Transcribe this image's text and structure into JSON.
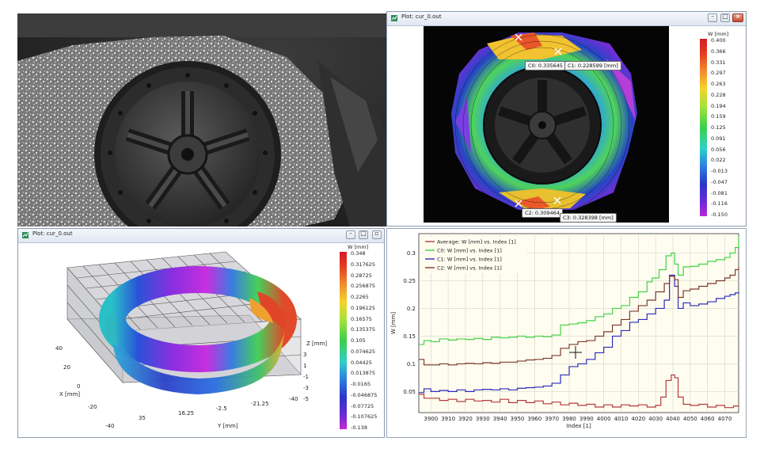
{
  "colors": {
    "window_border": "#8a9bb0",
    "plot_bg": "#fffdf0",
    "series_avg": "#b23b3b",
    "series_c0": "#43d143",
    "series_c1": "#2b2bbb",
    "series_c2": "#7b3a2a"
  },
  "photo": {
    "icon": "camera-photo-tire"
  },
  "top_window": {
    "title": "Plot: cur_0.out",
    "colorbar_title": "W [mm]",
    "colorbar_labels": [
      "0.400",
      "0.366",
      "0.331",
      "0.297",
      "0.263",
      "0.228",
      "0.194",
      "0.159",
      "0.125",
      "0.091",
      "0.056",
      "0.022",
      "-0.013",
      "-0.047",
      "-0.081",
      "-0.116",
      "-0.150"
    ],
    "tags": {
      "c0": "C0: 0.335645",
      "c1": "C1: 0.228599 [mm]",
      "c2": "C2: 0.309464",
      "c3": "C3: 0.328398 [mm]"
    }
  },
  "bottom_left_window": {
    "title": "Plot: cur_0.out",
    "colorbar_title": "W [mm]",
    "colorbar_labels": [
      "0.348",
      "0.317625",
      "0.28725",
      "0.256875",
      "0.2265",
      "0.196125",
      "0.16575",
      "0.135375",
      "0.105",
      "0.074625",
      "0.04425",
      "0.013875",
      "-0.0165",
      "-0.046875",
      "-0.07725",
      "-0.107625",
      "-0.138"
    ],
    "x_axis_title": "X [mm]",
    "x_ticks": [
      "40",
      "20",
      "0",
      "-20",
      "-40"
    ],
    "y_axis_title": "Y [mm]",
    "y_ticks": [
      "35",
      "16.25",
      "-2.5",
      "-21.25",
      "-40"
    ],
    "z_axis_title": "Z [mm]",
    "z_ticks": [
      "3",
      "1",
      "-1",
      "-3",
      "-5"
    ]
  },
  "chart_data": {
    "type": "line",
    "title": "",
    "xlabel": "Index [1]",
    "ylabel": "W [mm]",
    "xlim": [
      3893,
      4078
    ],
    "ylim": [
      0.012,
      0.335
    ],
    "x_ticks": [
      3900,
      3910,
      3920,
      3930,
      3940,
      3950,
      3960,
      3970,
      3980,
      3990,
      4000,
      4010,
      4020,
      4030,
      4040,
      4050,
      4060,
      4070
    ],
    "y_ticks": [
      0.05,
      0.1,
      0.15,
      0.2,
      0.25,
      0.3
    ],
    "y_tick_labels": [
      "0.05",
      "0.1",
      "0.15",
      "0.2",
      "0.25",
      "0.3"
    ],
    "grid": true,
    "legend_position": "top-left",
    "series": [
      {
        "name": "Average: W [mm] vs. Index [1]",
        "color": "#b23b3b",
        "x": [
          3893,
          3896,
          3900,
          3905,
          3910,
          3915,
          3920,
          3925,
          3930,
          3935,
          3940,
          3945,
          3950,
          3955,
          3960,
          3965,
          3970,
          3975,
          3980,
          3985,
          3990,
          3995,
          4000,
          4005,
          4010,
          4015,
          4020,
          4025,
          4030,
          4033,
          4036,
          4039,
          4041,
          4043,
          4046,
          4050,
          4055,
          4060,
          4065,
          4070,
          4075,
          4078
        ],
        "y": [
          0.045,
          0.038,
          0.038,
          0.034,
          0.036,
          0.032,
          0.036,
          0.033,
          0.034,
          0.031,
          0.036,
          0.03,
          0.034,
          0.03,
          0.033,
          0.028,
          0.031,
          0.026,
          0.029,
          0.025,
          0.027,
          0.022,
          0.026,
          0.022,
          0.026,
          0.024,
          0.026,
          0.022,
          0.025,
          0.04,
          0.07,
          0.08,
          0.075,
          0.04,
          0.027,
          0.025,
          0.027,
          0.022,
          0.025,
          0.021,
          0.024,
          0.022
        ]
      },
      {
        "name": "C0: W [mm] vs. Index [1]",
        "color": "#43d143",
        "x": [
          3893,
          3896,
          3900,
          3905,
          3910,
          3915,
          3920,
          3925,
          3930,
          3935,
          3940,
          3945,
          3950,
          3955,
          3960,
          3965,
          3970,
          3975,
          3980,
          3985,
          3990,
          3995,
          4000,
          4005,
          4010,
          4015,
          4020,
          4025,
          4028,
          4032,
          4036,
          4039,
          4041,
          4043,
          4046,
          4050,
          4055,
          4060,
          4065,
          4070,
          4073,
          4076,
          4078
        ],
        "y": [
          0.135,
          0.142,
          0.14,
          0.145,
          0.143,
          0.145,
          0.144,
          0.146,
          0.144,
          0.148,
          0.147,
          0.148,
          0.15,
          0.148,
          0.15,
          0.149,
          0.152,
          0.17,
          0.172,
          0.174,
          0.178,
          0.185,
          0.19,
          0.2,
          0.205,
          0.22,
          0.23,
          0.248,
          0.255,
          0.27,
          0.295,
          0.3,
          0.28,
          0.26,
          0.275,
          0.276,
          0.28,
          0.285,
          0.288,
          0.292,
          0.3,
          0.31,
          0.33
        ]
      },
      {
        "name": "C1: W [mm] vs. Index [1]",
        "color": "#2b2bbb",
        "x": [
          3893,
          3896,
          3900,
          3905,
          3910,
          3915,
          3920,
          3925,
          3930,
          3935,
          3940,
          3945,
          3950,
          3955,
          3960,
          3965,
          3970,
          3975,
          3980,
          3985,
          3990,
          3995,
          4000,
          4005,
          4010,
          4015,
          4020,
          4025,
          4030,
          4035,
          4038,
          4041,
          4043,
          4046,
          4050,
          4055,
          4060,
          4065,
          4070,
          4073,
          4076,
          4078
        ],
        "y": [
          0.048,
          0.055,
          0.05,
          0.052,
          0.05,
          0.053,
          0.05,
          0.053,
          0.054,
          0.053,
          0.055,
          0.053,
          0.056,
          0.057,
          0.058,
          0.06,
          0.065,
          0.08,
          0.095,
          0.1,
          0.108,
          0.12,
          0.13,
          0.15,
          0.16,
          0.175,
          0.18,
          0.19,
          0.2,
          0.215,
          0.26,
          0.24,
          0.2,
          0.21,
          0.205,
          0.208,
          0.212,
          0.218,
          0.222,
          0.225,
          0.228,
          0.23
        ]
      },
      {
        "name": "C2: W [mm] vs. Index [1]",
        "color": "#7b3a2a",
        "x": [
          3893,
          3896,
          3900,
          3905,
          3910,
          3915,
          3920,
          3925,
          3930,
          3935,
          3940,
          3945,
          3950,
          3955,
          3960,
          3965,
          3970,
          3975,
          3980,
          3985,
          3990,
          3995,
          4000,
          4005,
          4010,
          4015,
          4020,
          4025,
          4030,
          4035,
          4038,
          4041,
          4043,
          4046,
          4050,
          4055,
          4060,
          4065,
          4070,
          4073,
          4076,
          4078
        ],
        "y": [
          0.108,
          0.098,
          0.098,
          0.1,
          0.098,
          0.1,
          0.101,
          0.1,
          0.102,
          0.101,
          0.103,
          0.103,
          0.105,
          0.107,
          0.108,
          0.11,
          0.115,
          0.128,
          0.135,
          0.14,
          0.142,
          0.15,
          0.158,
          0.17,
          0.18,
          0.195,
          0.205,
          0.215,
          0.23,
          0.245,
          0.258,
          0.252,
          0.22,
          0.232,
          0.235,
          0.24,
          0.245,
          0.25,
          0.255,
          0.26,
          0.27,
          0.275
        ]
      }
    ]
  }
}
